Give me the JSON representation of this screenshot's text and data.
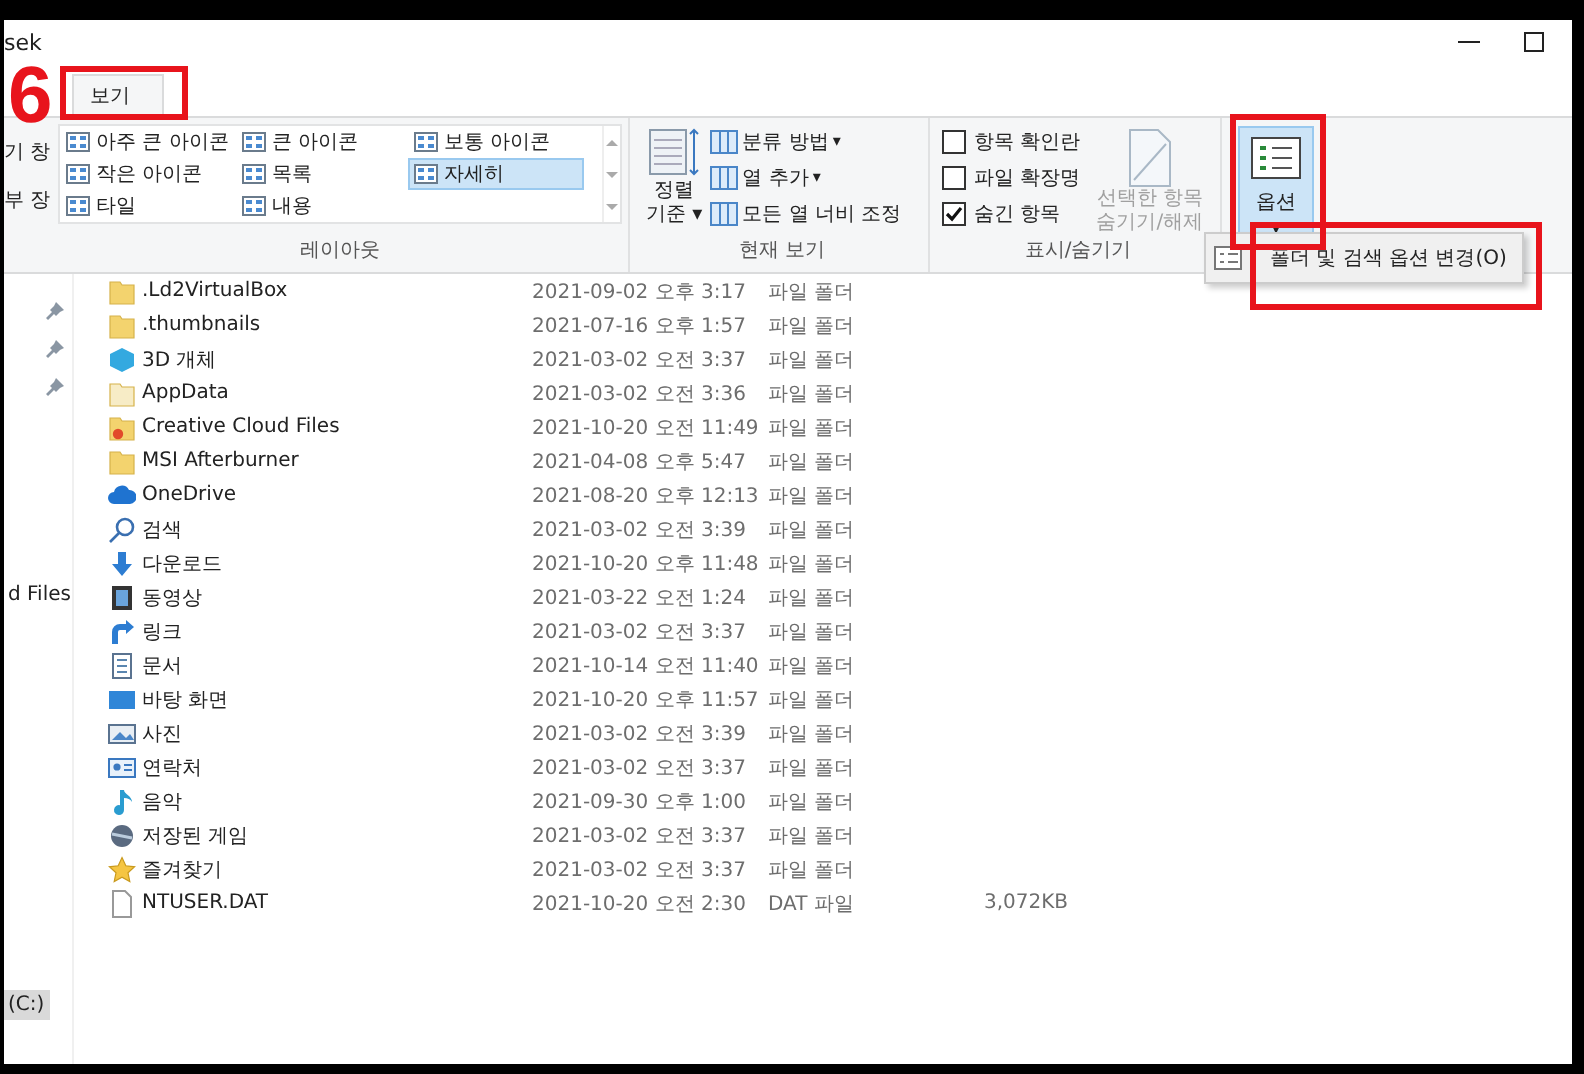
{
  "window": {
    "title": "sek"
  },
  "step_number": "6",
  "tabs": [
    {
      "label": "보기",
      "selected": true,
      "highlighted": true
    }
  ],
  "ribbon": {
    "partial_group": {
      "items": [
        "기 창",
        "부 장"
      ]
    },
    "layout": {
      "label": "레이아웃",
      "items": [
        {
          "label": "아주 큰 아이콘",
          "selected": false
        },
        {
          "label": "큰 아이콘",
          "selected": false
        },
        {
          "label": "보통 아이콘",
          "selected": false
        },
        {
          "label": "작은 아이콘",
          "selected": false
        },
        {
          "label": "목록",
          "selected": false
        },
        {
          "label": "자세히",
          "selected": true
        },
        {
          "label": "타일",
          "selected": false
        },
        {
          "label": "내용",
          "selected": false
        }
      ]
    },
    "current_view": {
      "label": "현재 보기",
      "sort_button": {
        "line1": "정렬",
        "line2": "기준",
        "arrow": "▾"
      },
      "items": [
        {
          "label": "분류 방법",
          "arrow": "▾"
        },
        {
          "label": "열 추가",
          "arrow": "▾"
        },
        {
          "label": "모든 열 너비 조정"
        }
      ]
    },
    "show_hide": {
      "label": "표시/숨기기",
      "checkboxes": [
        {
          "label": "항목 확인란",
          "checked": false
        },
        {
          "label": "파일 확장명",
          "checked": false
        },
        {
          "label": "숨긴 항목",
          "checked": true
        }
      ],
      "hide_button": {
        "line1": "선택한 항목",
        "line2": "숨기기/해제",
        "disabled": true
      }
    },
    "options_button": {
      "label": "옵션",
      "arrow": "▾",
      "selected": true,
      "highlighted": true
    }
  },
  "options_menu": [
    {
      "label": "폴더 및 검색 옵션 변경(O)",
      "highlighted": true
    }
  ],
  "nav_pane": {
    "pins": [
      {
        "kind": "pin"
      },
      {
        "kind": "pin"
      },
      {
        "kind": "pin"
      }
    ],
    "items": [
      {
        "label": "d Files",
        "selected": false
      },
      {
        "label": "(C:)",
        "selected": true
      }
    ]
  },
  "files": [
    {
      "kind": "folder",
      "name": ".Ld2VirtualBox",
      "date": "2021-09-02 오후 3:17",
      "type": "파일 폴더"
    },
    {
      "kind": "folder",
      "name": ".thumbnails",
      "date": "2021-07-16 오후 1:57",
      "type": "파일 폴더"
    },
    {
      "kind": "cube",
      "name": "3D 개체",
      "date": "2021-03-02 오전 3:37",
      "type": "파일 폴더"
    },
    {
      "kind": "folder-faded",
      "name": "AppData",
      "date": "2021-03-02 오전 3:36",
      "type": "파일 폴더"
    },
    {
      "kind": "cloud-folder",
      "name": "Creative Cloud Files",
      "date": "2021-10-20 오전 11:49",
      "type": "파일 폴더"
    },
    {
      "kind": "folder",
      "name": "MSI Afterburner",
      "date": "2021-04-08 오후 5:47",
      "type": "파일 폴더"
    },
    {
      "kind": "cloud",
      "name": "OneDrive",
      "date": "2021-08-20 오후 12:13",
      "type": "파일 폴더"
    },
    {
      "kind": "search",
      "name": "검색",
      "date": "2021-03-02 오전 3:39",
      "type": "파일 폴더"
    },
    {
      "kind": "download",
      "name": "다운로드",
      "date": "2021-10-20 오후 11:48",
      "type": "파일 폴더"
    },
    {
      "kind": "film",
      "name": "동영상",
      "date": "2021-03-22 오전 1:24",
      "type": "파일 폴더"
    },
    {
      "kind": "link",
      "name": "링크",
      "date": "2021-03-02 오전 3:37",
      "type": "파일 폴더"
    },
    {
      "kind": "document",
      "name": "문서",
      "date": "2021-10-14 오전 11:40",
      "type": "파일 폴더"
    },
    {
      "kind": "desktop",
      "name": "바탕 화면",
      "date": "2021-10-20 오후 11:57",
      "type": "파일 폴더"
    },
    {
      "kind": "photo",
      "name": "사진",
      "date": "2021-03-02 오전 3:39",
      "type": "파일 폴더"
    },
    {
      "kind": "contact",
      "name": "연락처",
      "date": "2021-03-02 오전 3:37",
      "type": "파일 폴더"
    },
    {
      "kind": "music",
      "name": "음악",
      "date": "2021-09-30 오후 1:00",
      "type": "파일 폴더"
    },
    {
      "kind": "game",
      "name": "저장된 게임",
      "date": "2021-03-02 오전 3:37",
      "type": "파일 폴더"
    },
    {
      "kind": "star",
      "name": "즐겨찾기",
      "date": "2021-03-02 오전 3:37",
      "type": "파일 폴더"
    },
    {
      "kind": "file",
      "name": "NTUSER.DAT",
      "date": "2021-10-20 오전 2:30",
      "type": "DAT 파일",
      "size": "3,072KB"
    }
  ]
}
